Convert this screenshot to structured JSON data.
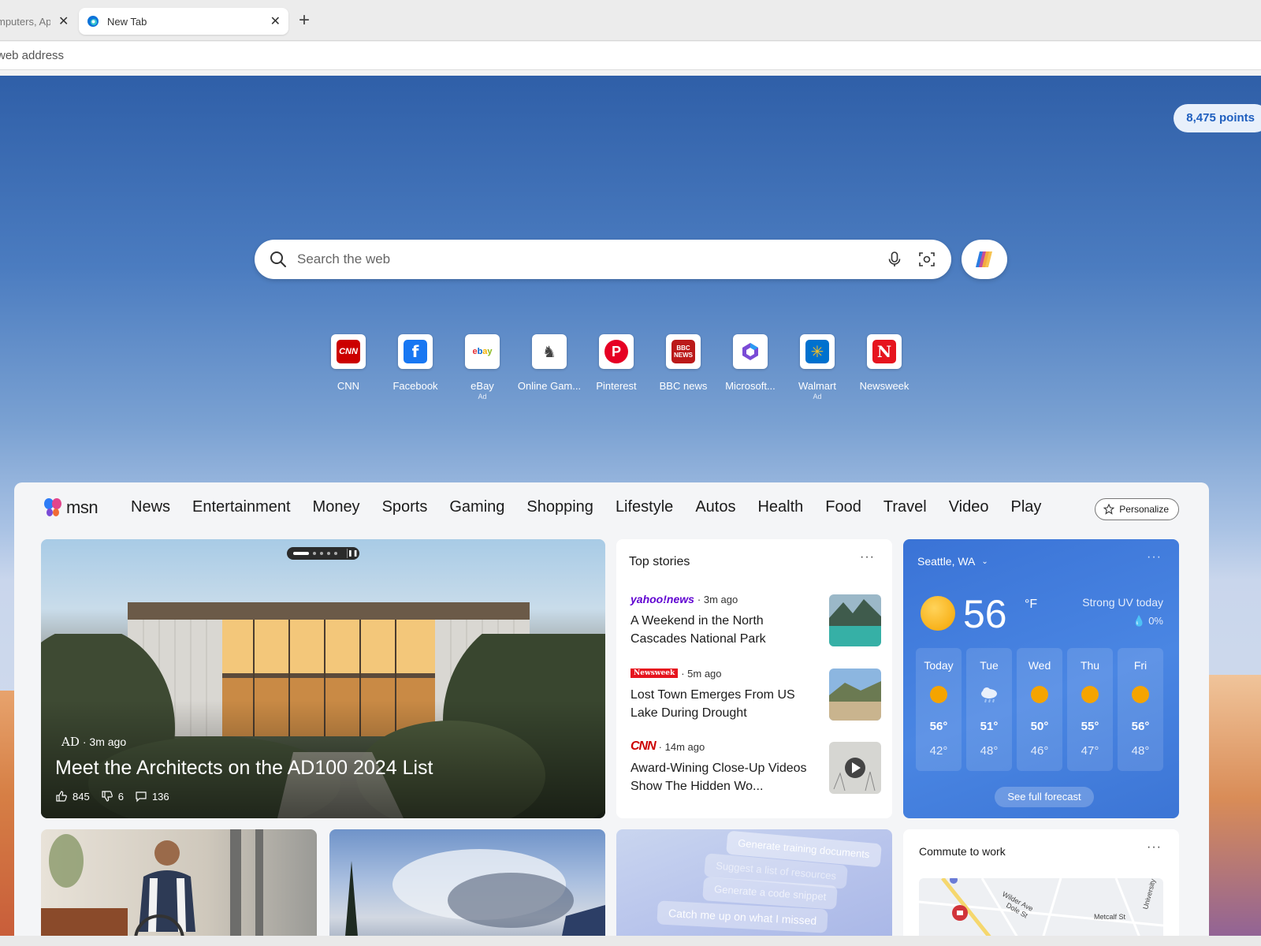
{
  "browser": {
    "tabs": [
      {
        "title": "mputers, Ap",
        "active": false
      },
      {
        "title": "New Tab",
        "active": true
      }
    ],
    "address_bar": {
      "text": "web address"
    }
  },
  "ntp": {
    "points": "8,475 points",
    "search": {
      "placeholder": "Search the web"
    },
    "quicklinks": [
      {
        "label": "CNN",
        "ad": "",
        "color": "#cc0000"
      },
      {
        "label": "Facebook",
        "ad": "",
        "color": "#1877f2"
      },
      {
        "label": "eBay",
        "ad": "Ad",
        "color": "#e53238"
      },
      {
        "label": "Online Gam...",
        "ad": "",
        "color": "#444444"
      },
      {
        "label": "Pinterest",
        "ad": "",
        "color": "#e60023"
      },
      {
        "label": "BBC news",
        "ad": "",
        "color": "#bb1919"
      },
      {
        "label": "Microsoft...",
        "ad": "",
        "color": "#7a4bd6"
      },
      {
        "label": "Walmart",
        "ad": "Ad",
        "color": "#0071ce"
      },
      {
        "label": "Newsweek",
        "ad": "",
        "color": "#e6141e"
      }
    ]
  },
  "feed": {
    "brand": "msn",
    "nav": [
      "News",
      "Entertainment",
      "Money",
      "Sports",
      "Gaming",
      "Shopping",
      "Lifestyle",
      "Autos",
      "Health",
      "Food",
      "Travel",
      "Video",
      "Play"
    ],
    "personalize_label": "Personalize",
    "hero": {
      "source_logo": "AD",
      "time": "· 3m ago",
      "title": "Meet the Architects on the AD100 2024 List",
      "likes": "845",
      "dislikes": "6",
      "comments": "136"
    },
    "top_stories": {
      "title": "Top stories",
      "items": [
        {
          "source": "yahoo!news",
          "time": "· 3m ago",
          "headline": "A Weekend in the North Cascades National Park"
        },
        {
          "source": "Newsweek",
          "time": "· 5m ago",
          "headline": "Lost Town Emerges From US Lake During Drought"
        },
        {
          "source": "CNN",
          "time": "· 14m ago",
          "headline": "Award-Wining Close-Up Videos Show The Hidden Wo..."
        }
      ]
    },
    "weather": {
      "location": "Seattle, WA",
      "temp": "56",
      "unit": "°F",
      "condition": "Strong UV today",
      "precip": "0%",
      "days": [
        {
          "name": "Today",
          "high": "56°",
          "low": "42°",
          "icon": "sun"
        },
        {
          "name": "Tue",
          "high": "51°",
          "low": "48°",
          "icon": "rain"
        },
        {
          "name": "Wed",
          "high": "50°",
          "low": "46°",
          "icon": "sun"
        },
        {
          "name": "Thu",
          "high": "55°",
          "low": "47°",
          "icon": "sun"
        },
        {
          "name": "Fri",
          "high": "56°",
          "low": "48°",
          "icon": "sun"
        }
      ],
      "forecast_label": "See full forecast"
    },
    "copilot_prompts": [
      "Generate training documents",
      "Suggest a list of resources",
      "Generate a code snippet",
      "Catch me up on what I missed"
    ],
    "commute": {
      "title": "Commute to work",
      "streets": [
        "Wilder Ave",
        "Dole St",
        "Metcalf St",
        "University"
      ]
    }
  },
  "colors": {
    "accent": "#1f5fbf",
    "weather_bg": "#3a73d6",
    "sun": "#f5a400"
  }
}
